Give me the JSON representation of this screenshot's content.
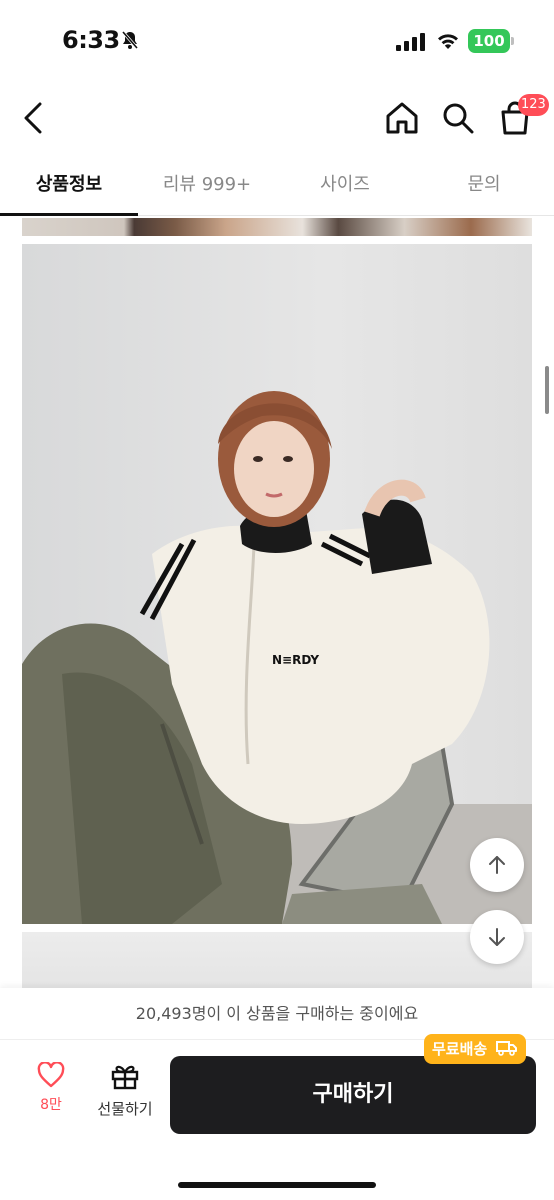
{
  "status_bar": {
    "time": "6:33",
    "battery": "100"
  },
  "nav": {
    "cart_badge": "123"
  },
  "tabs": [
    {
      "label": "상품정보",
      "active": true
    },
    {
      "label": "리뷰 999+",
      "active": false
    },
    {
      "label": "사이즈",
      "active": false
    },
    {
      "label": "문의",
      "active": false
    }
  ],
  "product": {
    "shirt_logo": "N≡RDY"
  },
  "bottom": {
    "purchase_note": "20,493명이 이 상품을 구매하는 중이에요",
    "like_count": "8만",
    "gift_label": "선물하기",
    "buy_label": "구매하기",
    "free_shipping": "무료배송"
  },
  "colors": {
    "accent_red": "#ff4d57",
    "badge_orange": "#ffb31a",
    "battery_green": "#34c759",
    "button_dark": "#1d1d1f"
  }
}
